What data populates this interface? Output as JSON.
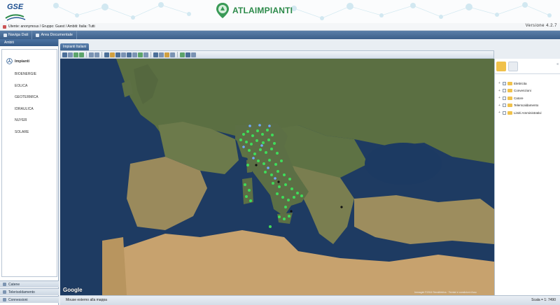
{
  "header": {
    "gse_logo_text": "GSE",
    "app_title": "ATLAIMPIANTI",
    "version": "Versione 4.2.7",
    "user_line": "Utente: anonymous / Gruppo: Guest / Ambiti: Italia: Tutti"
  },
  "nav": {
    "items": [
      {
        "label": "Naviga Dati"
      },
      {
        "label": "Area Documentale"
      }
    ]
  },
  "left_panel": {
    "header": "Ambiti",
    "title": "Impianti",
    "items": [
      {
        "label": "BIOENERGIE"
      },
      {
        "label": "EOLICA"
      },
      {
        "label": "GEOTERMICA"
      },
      {
        "label": "IDRAULICA"
      },
      {
        "label": "NUYER"
      },
      {
        "label": "SOLARE"
      }
    ],
    "footer": [
      {
        "label": "Catene"
      },
      {
        "label": "Telerisoldamento"
      },
      {
        "label": "Connessioni"
      }
    ]
  },
  "map": {
    "tab_label": "Impianti Italiani",
    "google_label": "Google",
    "attribution": "Immagini ©2016 TerraMetrics · Termini e condizioni d'uso",
    "status_text": "Mouse esterno alla mappa",
    "scale_text": "Scala = 1: 7490"
  },
  "layers": {
    "items": [
      {
        "label": "Elettricita",
        "checked": true
      },
      {
        "label": "Convenzioni",
        "checked": false
      },
      {
        "label": "Catore",
        "checked": false
      },
      {
        "label": "Telerscaldamento",
        "checked": false
      },
      {
        "label": "Limiti Amministrativi",
        "checked": false
      }
    ]
  },
  "colors": {
    "accent_green": "#2c8a4a",
    "header_blue": "#3c5f8a",
    "plant_marker": "#3fdc5a",
    "plant_marker_blue": "#6fa8ff"
  }
}
